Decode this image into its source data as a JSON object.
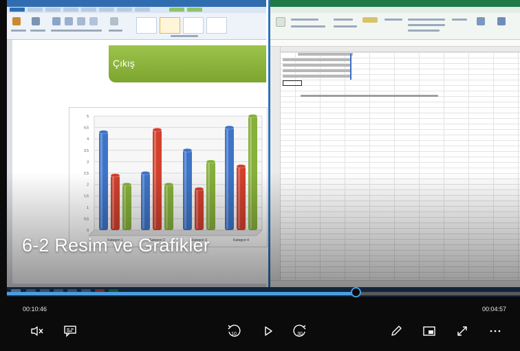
{
  "player": {
    "caption": "6-2 Resim ve Grafikler",
    "elapsed": "00:10:46",
    "remaining": "00:04:57",
    "progress": 0.68,
    "skip_back_seconds": "10",
    "skip_forward_seconds": "30",
    "accent_color": "#4a9ee0",
    "controls": [
      "mute-icon",
      "subtitles-icon",
      "skip-back-icon",
      "play-icon",
      "skip-forward-icon",
      "pen-icon",
      "mini-view-icon",
      "fullscreen-icon",
      "more-icon"
    ]
  },
  "slide": {
    "title": "Çıkış",
    "title_bar_color": "#8cb63c"
  },
  "chart_data": {
    "type": "bar",
    "categories": [
      "Kategori 1",
      "Kategori 2",
      "Kategori 3",
      "Kategori 4"
    ],
    "series": [
      {
        "values": [
          4.3,
          2.5,
          3.5,
          4.5
        ],
        "color": "#3e74c8"
      },
      {
        "values": [
          2.4,
          4.4,
          1.8,
          2.8
        ],
        "color": "#d2402e"
      },
      {
        "values": [
          2.0,
          2.0,
          3.0,
          5.0
        ],
        "color": "#86b03a"
      }
    ],
    "ylim": [
      0,
      5
    ],
    "yticks": [
      "0",
      "0,5",
      "1",
      "1,5",
      "2",
      "2,5",
      "3",
      "3,5",
      "4",
      "4,5",
      "5"
    ],
    "grid": true
  }
}
